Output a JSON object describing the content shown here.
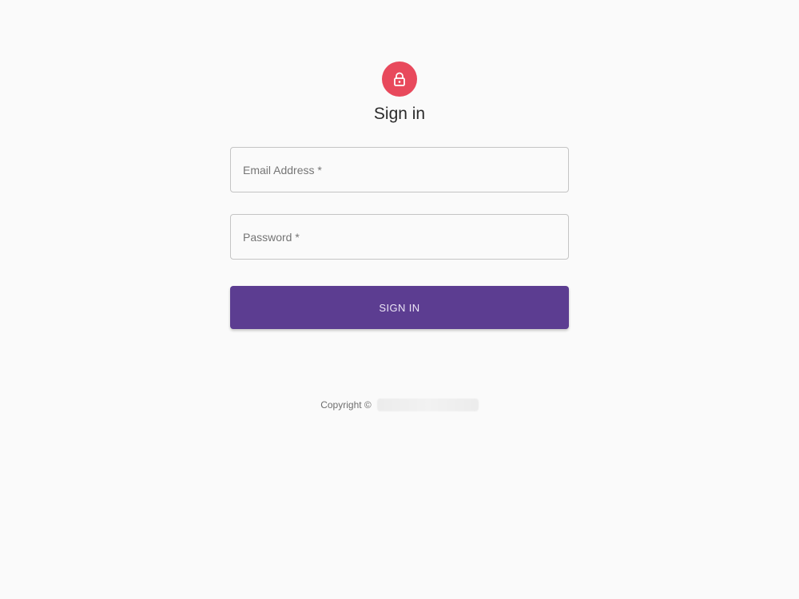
{
  "header": {
    "icon": "lock-icon",
    "title": "Sign in"
  },
  "form": {
    "email_placeholder": "Email Address *",
    "email_value": "",
    "password_placeholder": "Password *",
    "password_value": "",
    "submit_label": "SIGN IN"
  },
  "footer": {
    "copyright_label": "Copyright ©"
  },
  "colors": {
    "avatar": "#e8495c",
    "button": "#5c3d91",
    "background": "#fafafa"
  }
}
